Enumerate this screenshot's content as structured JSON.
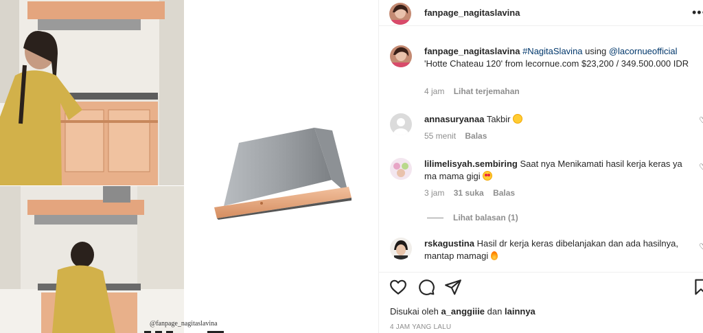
{
  "media": {
    "watermark": "@fanpage_nagitaslavina"
  },
  "header": {
    "username": "fanpage_nagitaslavina",
    "more_icon": "more-horizontal-icon"
  },
  "caption": {
    "username": "fanpage_nagitaslavina",
    "hashtag": "#NagitaSlavina",
    "text_mid": " using ",
    "mention": "@lacornueofficial",
    "text_end": " 'Hotte Chateau 120' from lecornue.com $23,200 / 349.500.000 IDR",
    "time": "4 jam",
    "translate": "Lihat terjemahan"
  },
  "comments": [
    {
      "username": "annasuryanaa",
      "text": "Takbir",
      "emoji": "laughing-crying-emoji",
      "time": "55 menit",
      "reply": "Balas"
    },
    {
      "username": "lilimelisyah.sembiring",
      "text": "Saat nya Menikamati hasil kerja keras ya ma mama gigi",
      "emoji": "heart-eyes-emoji",
      "time": "3 jam",
      "likes": "31 suka",
      "reply": "Balas",
      "view_replies": "Lihat balasan (1)"
    },
    {
      "username": "rskagustina",
      "text": "Hasil dr kerja keras dibelanjakan dan ada hasilnya, mantap mamagi",
      "emoji": "fire-emoji"
    }
  ],
  "actions": {
    "like_icon": "heart-icon",
    "comment_icon": "comment-icon",
    "share_icon": "paper-plane-icon",
    "save_icon": "bookmark-icon"
  },
  "likes": {
    "prefix": "Disukai oleh",
    "user": "a_anggiiie",
    "mid": "dan",
    "others": "lainnya"
  },
  "posted": "4 JAM YANG LALU",
  "colors": {
    "link": "#00376b",
    "secondary": "#8e8e8e",
    "copper": "#e0a27a"
  }
}
